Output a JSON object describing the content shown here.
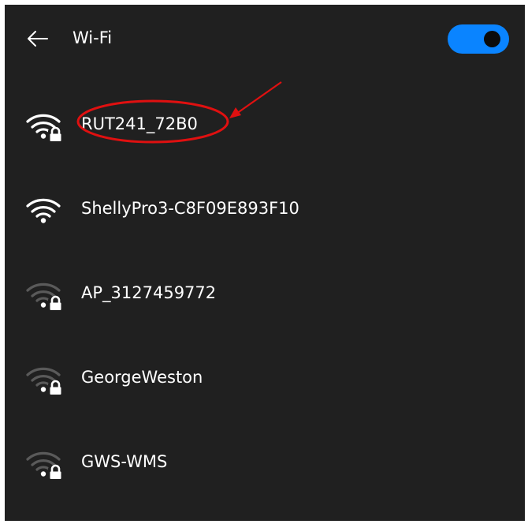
{
  "header": {
    "title": "Wi-Fi",
    "back_icon": "back-arrow-icon",
    "wifi_toggle": {
      "state": "on",
      "color": "#0a84ff"
    }
  },
  "networks": [
    {
      "name": "RUT241_72B0",
      "secured": true,
      "signal": "full",
      "highlighted": true
    },
    {
      "name": "ShellyPro3-C8F09E893F10",
      "secured": false,
      "signal": "full"
    },
    {
      "name": "AP_3127459772",
      "secured": true,
      "signal": "weak"
    },
    {
      "name": "GeorgeWeston",
      "secured": true,
      "signal": "weak"
    },
    {
      "name": "GWS-WMS",
      "secured": true,
      "signal": "weak"
    }
  ],
  "annotation": {
    "color": "#e01010"
  }
}
